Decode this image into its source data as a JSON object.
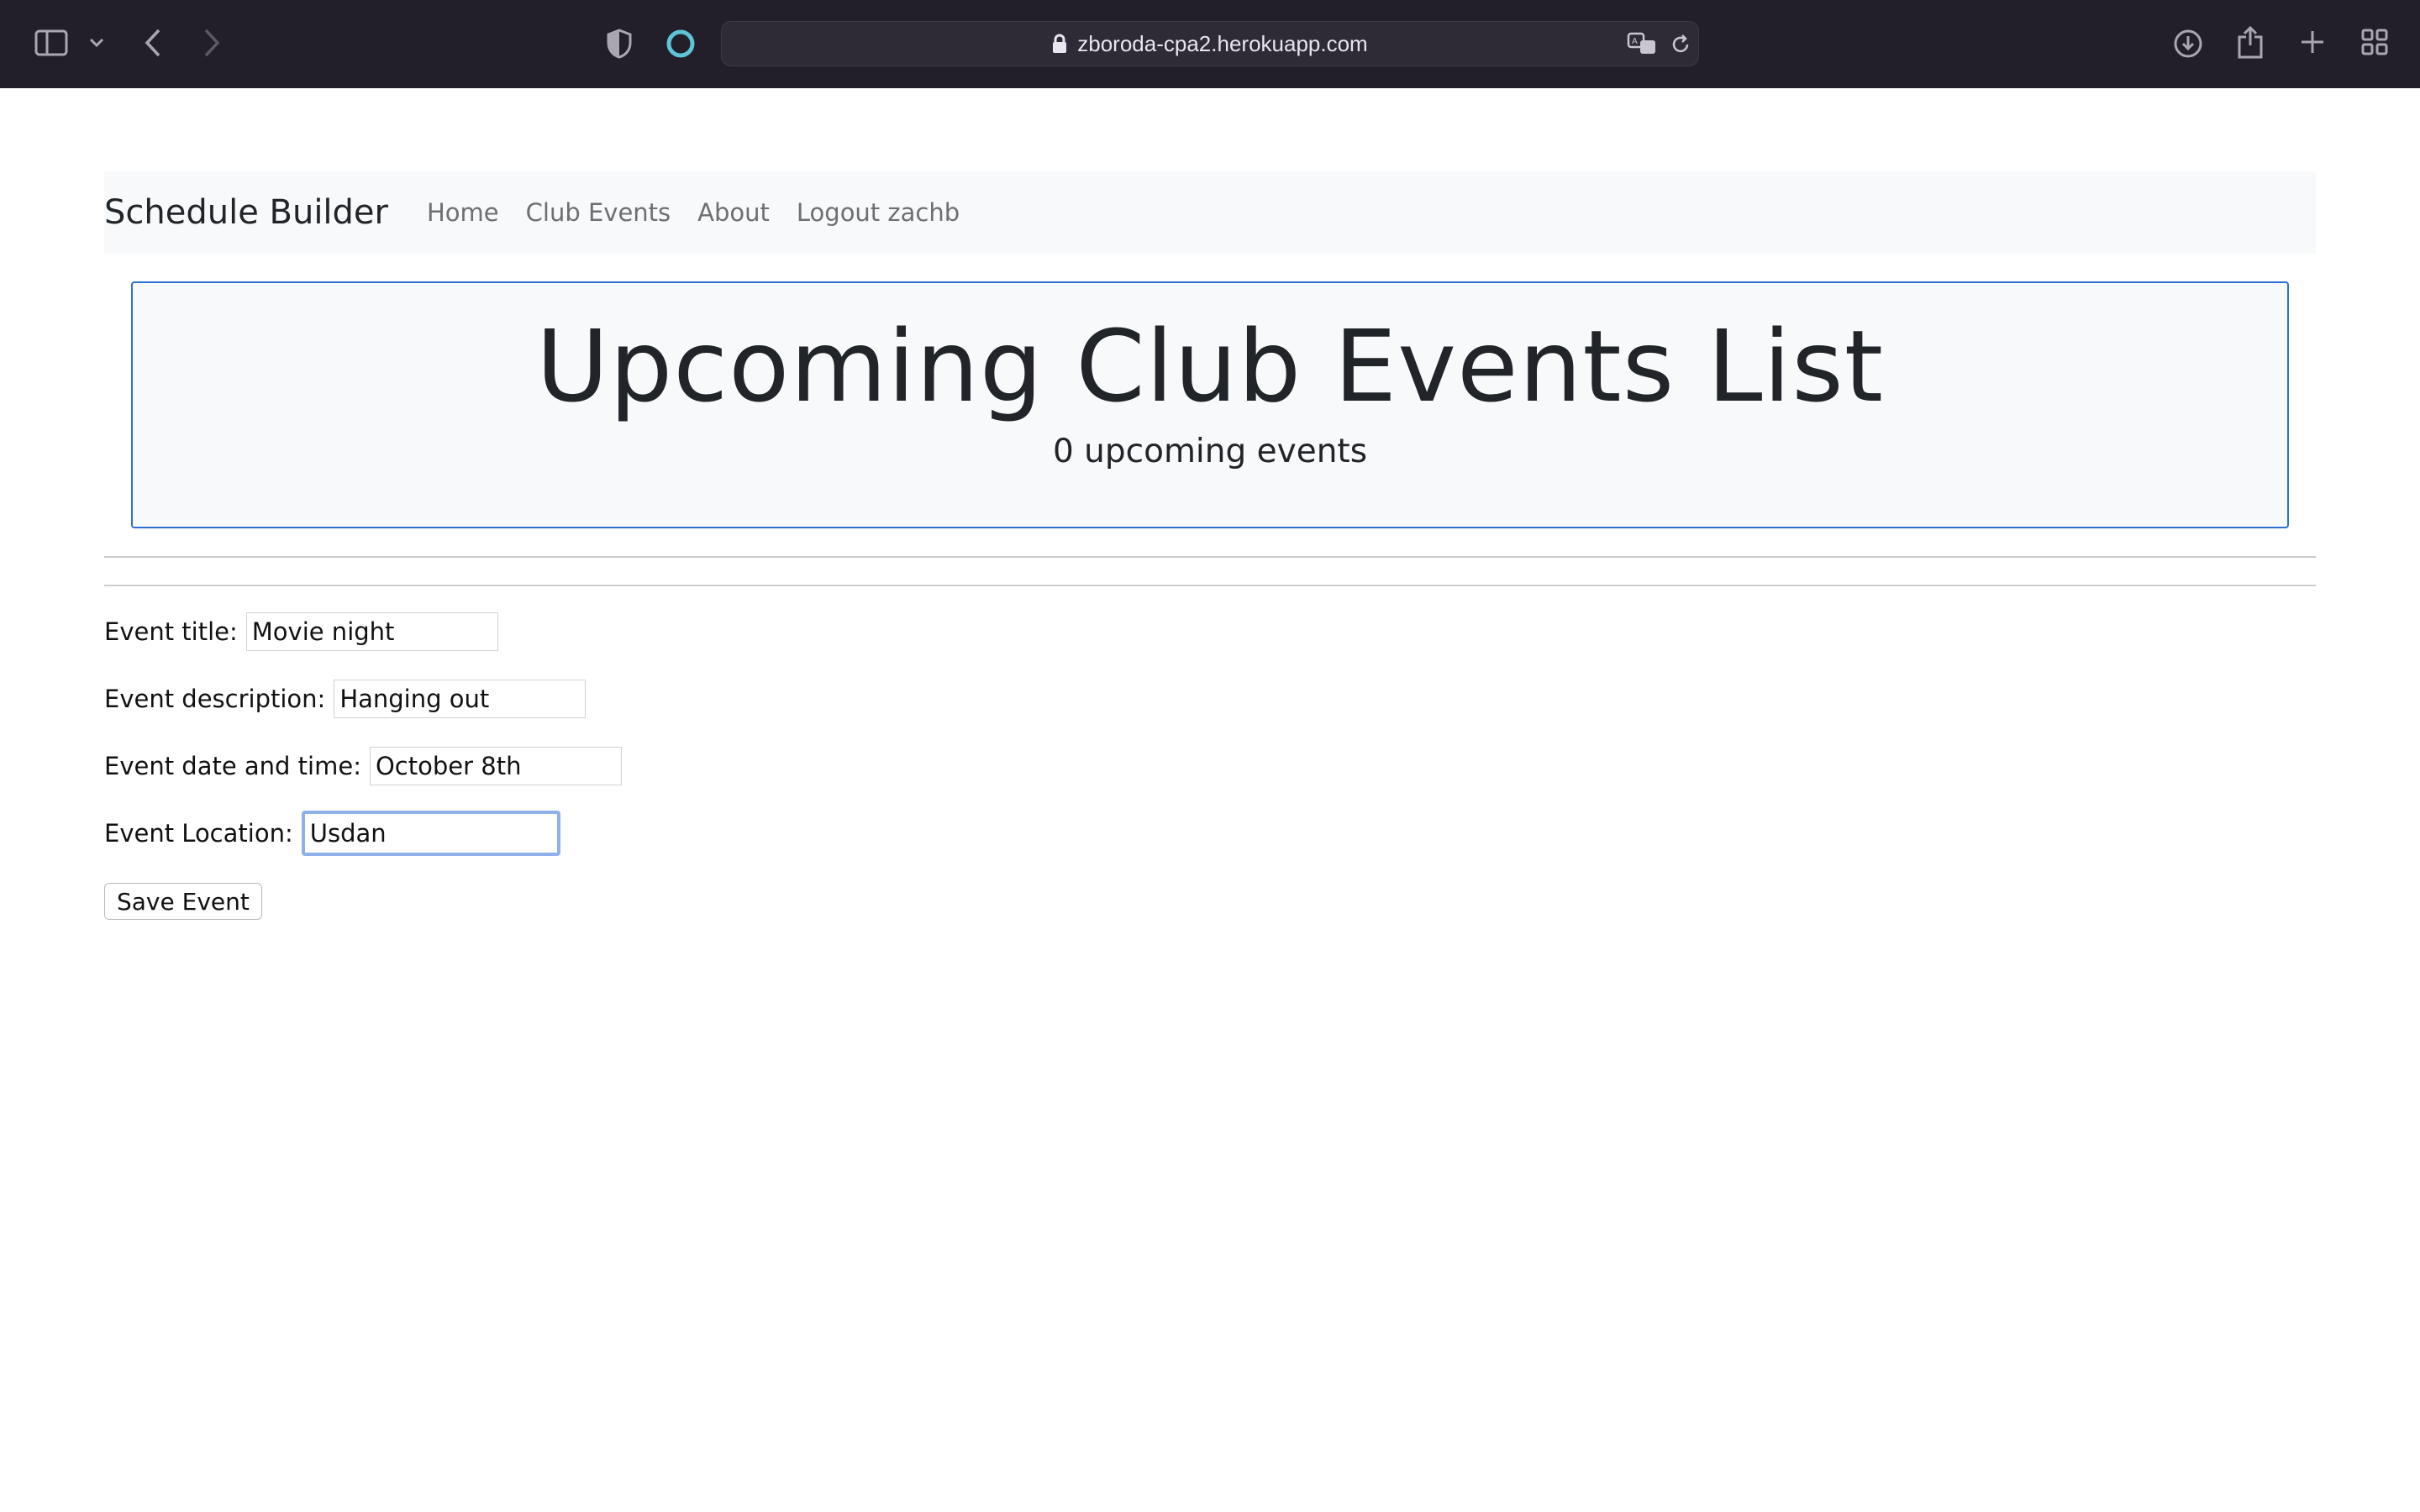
{
  "browser": {
    "url": "zboroda-cpa2.herokuapp.com",
    "icons": [
      "sidebar-icon",
      "chevron-down-icon",
      "back-icon",
      "forward-icon",
      "shield-icon",
      "extension-icon",
      "lock-icon",
      "translate-icon",
      "reload-icon",
      "download-icon",
      "share-icon",
      "new-tab-icon",
      "tab-overview-icon"
    ]
  },
  "navbar": {
    "brand": "Schedule Builder",
    "links": [
      "Home",
      "Club Events",
      "About",
      "Logout zachb"
    ]
  },
  "jumbotron": {
    "title": "Upcoming Club Events List",
    "subtitle": "0 upcoming events"
  },
  "form": {
    "fields": [
      {
        "label": "Event title:",
        "value": "Movie night"
      },
      {
        "label": "Event description:",
        "value": "Hanging out"
      },
      {
        "label": "Event date and time:",
        "value": "October 8th"
      },
      {
        "label": "Event Location:",
        "value": "Usdan"
      }
    ],
    "save_label": "Save Event"
  },
  "colors": {
    "chrome_bg": "#221f2b",
    "jumbotron_border": "#2f6fd1",
    "focus_ring": "#8fb0ea",
    "extension_accent": "#5fc3d6"
  }
}
